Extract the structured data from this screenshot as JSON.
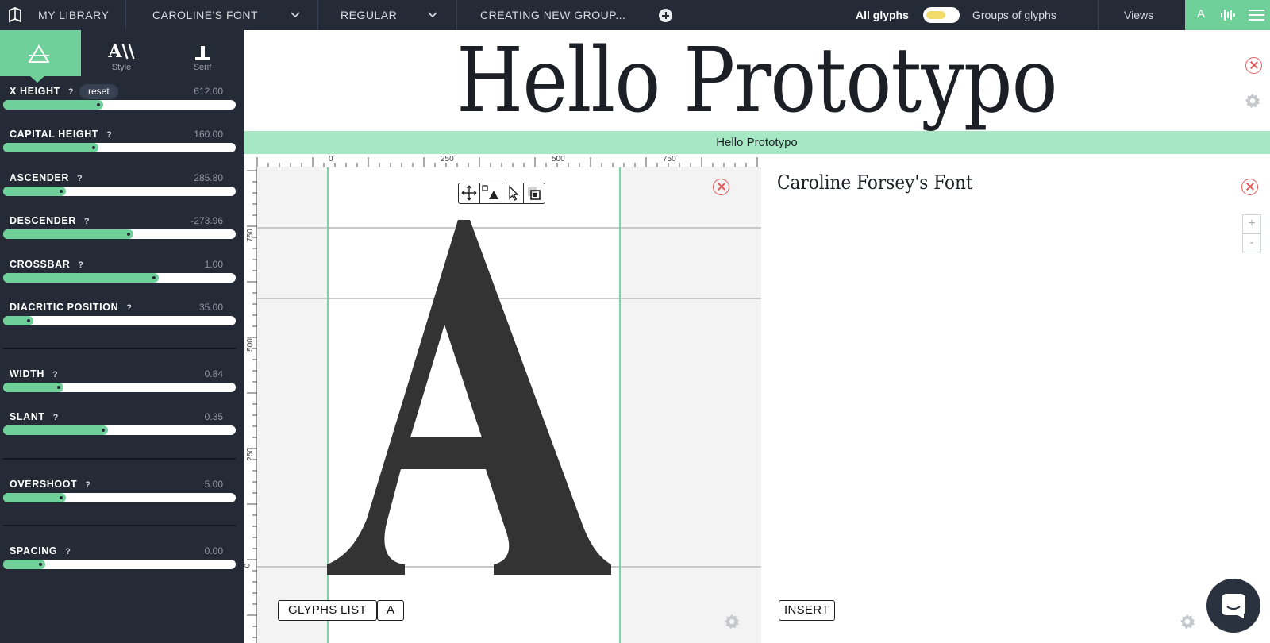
{
  "topbar": {
    "library": "MY LIBRARY",
    "font": "CAROLINE'S FONT",
    "variant": "REGULAR",
    "group": "CREATING NEW GROUP...",
    "all_glyphs": "All glyphs",
    "groups_of_glyphs": "Groups of glyphs",
    "views": "Views",
    "mode_letter": "A"
  },
  "sidebar": {
    "tabs": [
      {
        "label": "",
        "glyph": "A"
      },
      {
        "label": "Style",
        "glyph": "A\\\\"
      },
      {
        "label": "Serif",
        "glyph": "┴"
      }
    ],
    "reset_label": "reset",
    "params": [
      {
        "name": "X HEIGHT",
        "value": "612.00",
        "level": 0.43
      },
      {
        "name": "CAPITAL HEIGHT",
        "value": "160.00",
        "level": 0.41
      },
      {
        "name": "ASCENDER",
        "value": "285.80",
        "level": 0.27
      },
      {
        "name": "DESCENDER",
        "value": "-273.96",
        "level": 0.56
      },
      {
        "name": "CROSSBAR",
        "value": "1.00",
        "level": 0.67
      },
      {
        "name": "DIACRITIC POSITION",
        "value": "35.00",
        "level": 0.13
      },
      {
        "name": "WIDTH",
        "value": "0.84",
        "level": 0.26
      },
      {
        "name": "SLANT",
        "value": "0.35",
        "level": 0.45
      },
      {
        "name": "OVERSHOOT",
        "value": "5.00",
        "level": 0.27
      },
      {
        "name": "SPACING",
        "value": "0.00",
        "level": 0.18
      }
    ],
    "help": "?"
  },
  "preview": {
    "headline": "Hello Prototypo",
    "strip": "Hello Prototypo"
  },
  "editor": {
    "ruler_x": [
      "0",
      "250",
      "500",
      "750"
    ],
    "ruler_y": [
      "750",
      "500",
      "250",
      "0"
    ],
    "glyph": "A",
    "glyphs_list": "GLYPHS LIST",
    "current_glyph": "A"
  },
  "textpanel": {
    "title": "Caroline Forsey's Font",
    "insert": "INSERT",
    "zoom_in": "+",
    "zoom_out": "-"
  },
  "colors": {
    "accent": "#6fd09a",
    "strip": "#a6e8c4",
    "dark": "#242b36",
    "close": "#e35a5a",
    "toggle_knob": "#f2dd6b"
  },
  "icons": [
    "library-icon",
    "chevron-down-icon",
    "plus-circle-icon",
    "gear-icon",
    "close-icon",
    "move-tool-icon",
    "shape-tool-icon",
    "select-tool-icon",
    "component-tool-icon",
    "chat-icon",
    "menu-icon",
    "waveform-icon"
  ]
}
